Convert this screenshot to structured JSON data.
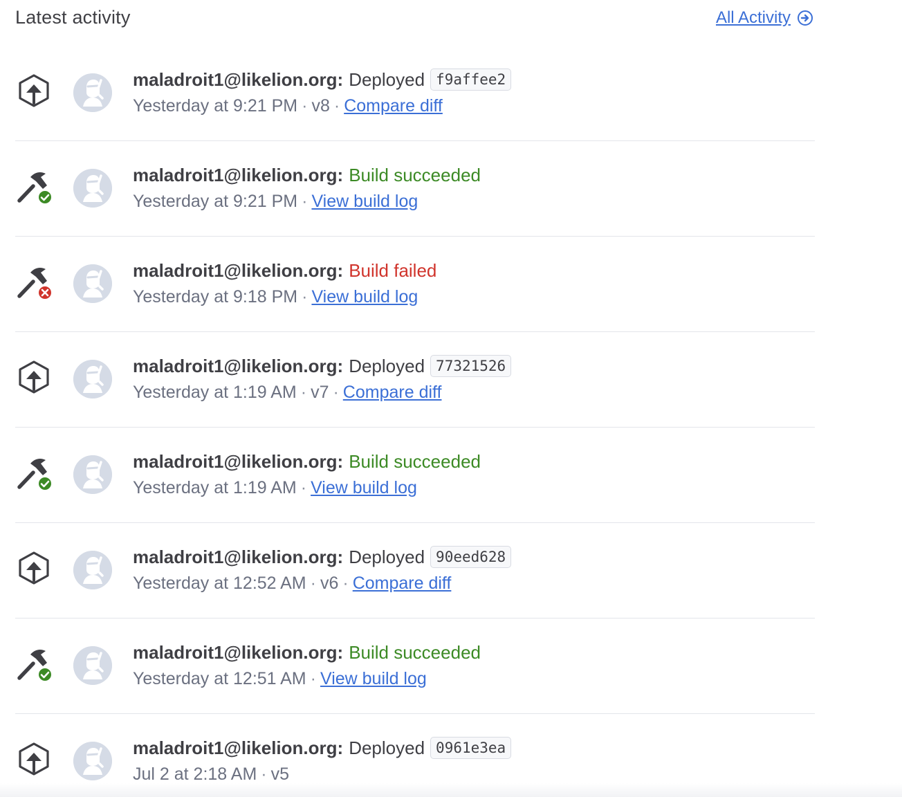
{
  "header": {
    "title": "Latest activity",
    "all_activity_label": "All Activity"
  },
  "colors": {
    "link": "#3b6fd6",
    "success": "#3c8a25",
    "failed": "#d0342c",
    "text": "#3f3f44",
    "muted": "#6b7080"
  },
  "activity": [
    {
      "kind": "deploy",
      "icon": "deploy-icon",
      "user": "maladroit1@likelion.org:",
      "action": "Deployed",
      "sha": "f9affee2",
      "time": "Yesterday at 9:21 PM",
      "version": "v8",
      "link": "Compare diff"
    },
    {
      "kind": "build-success",
      "icon": "build-success-icon",
      "user": "maladroit1@likelion.org:",
      "action": "Build succeeded",
      "time": "Yesterday at 9:21 PM",
      "link": "View build log"
    },
    {
      "kind": "build-failed",
      "icon": "build-failed-icon",
      "user": "maladroit1@likelion.org:",
      "action": "Build failed",
      "time": "Yesterday at 9:18 PM",
      "link": "View build log"
    },
    {
      "kind": "deploy",
      "icon": "deploy-icon",
      "user": "maladroit1@likelion.org:",
      "action": "Deployed",
      "sha": "77321526",
      "time": "Yesterday at 1:19 AM",
      "version": "v7",
      "link": "Compare diff"
    },
    {
      "kind": "build-success",
      "icon": "build-success-icon",
      "user": "maladroit1@likelion.org:",
      "action": "Build succeeded",
      "time": "Yesterday at 1:19 AM",
      "link": "View build log"
    },
    {
      "kind": "deploy",
      "icon": "deploy-icon",
      "user": "maladroit1@likelion.org:",
      "action": "Deployed",
      "sha": "90eed628",
      "time": "Yesterday at 12:52 AM",
      "version": "v6",
      "link": "Compare diff"
    },
    {
      "kind": "build-success",
      "icon": "build-success-icon",
      "user": "maladroit1@likelion.org:",
      "action": "Build succeeded",
      "time": "Yesterday at 12:51 AM",
      "link": "View build log"
    },
    {
      "kind": "deploy",
      "icon": "deploy-icon",
      "user": "maladroit1@likelion.org:",
      "action": "Deployed",
      "sha": "0961e3ea",
      "time": "Jul 2 at 2:18 AM",
      "version": "v5"
    }
  ]
}
